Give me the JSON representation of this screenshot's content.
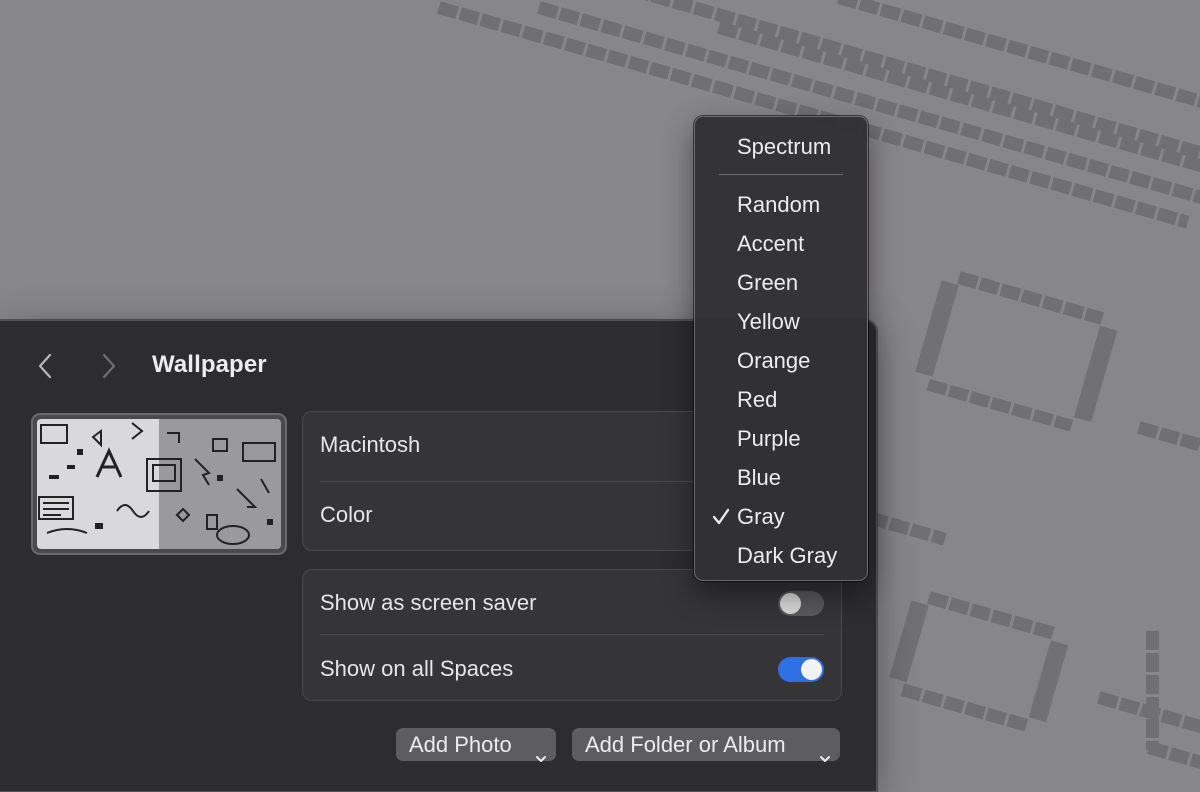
{
  "window": {
    "title": "Wallpaper"
  },
  "wallpaper": {
    "name": "Macintosh",
    "style_label": "Color"
  },
  "options": [
    {
      "label": "Show as screen saver",
      "enabled": false
    },
    {
      "label": "Show on all Spaces",
      "enabled": true
    }
  ],
  "buttons": {
    "add_photo": "Add Photo",
    "add_folder": "Add Folder or Album"
  },
  "color_menu": {
    "items": [
      "Spectrum",
      "Random",
      "Accent",
      "Green",
      "Yellow",
      "Orange",
      "Red",
      "Purple",
      "Blue",
      "Gray",
      "Dark Gray"
    ],
    "selected": "Gray"
  },
  "colors": {
    "desktop": "#87868b",
    "window": "#2d2c2e",
    "toggle_on": "#2f6fe4"
  },
  "icons": {
    "back": "chevron-left-icon",
    "forward": "chevron-right-icon",
    "check": "checkmark-icon",
    "dropdown": "chevron-down-icon"
  }
}
